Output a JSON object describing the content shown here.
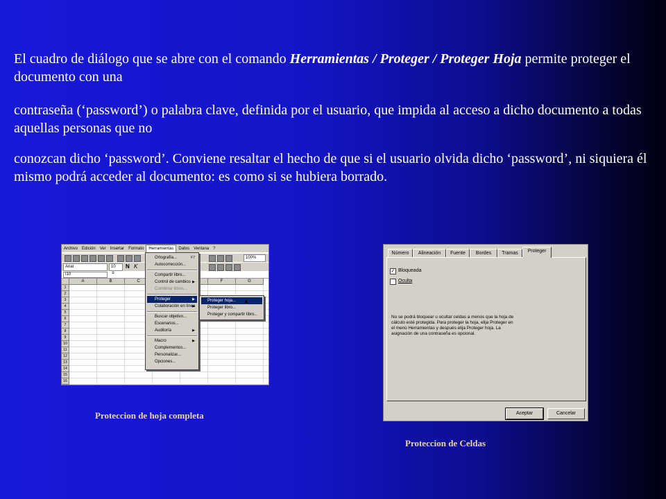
{
  "slide": {
    "para1_pre": "El cuadro de diálogo que se abre con el comando ",
    "para1_em": "Herramientas / Proteger / Proteger Hoja",
    "para1_post": " permite proteger el documento con una",
    "para2": "contraseña (‘password’) o palabra clave, definida por el usuario, que impida al acceso a dicho documento a todas aquellas personas que no",
    "para3": "conozcan dicho ‘password’. Conviene resaltar el hecho de que si el usuario olvida dicho ‘password’, ni siquiera él mismo podrá acceder al documento: es como si se hubiera borrado.",
    "caption_left": "Proteccion de hoja completa",
    "caption_right": "Proteccion de Celdas"
  },
  "excel": {
    "menubar": [
      "Archivo",
      "Edición",
      "Ver",
      "Insertar",
      "Formato",
      "Herramientas",
      "Datos",
      "Ventana",
      "?"
    ],
    "active_menu": "Herramientas",
    "font_name": "Arial",
    "font_size": "10",
    "zoom": "100%",
    "name_box": "I10",
    "columns": [
      "A",
      "B",
      "C",
      "D",
      "E",
      "F",
      "G"
    ],
    "rows": [
      "1",
      "2",
      "3",
      "4",
      "5",
      "6",
      "7",
      "8",
      "9",
      "10",
      "11",
      "12",
      "13",
      "14",
      "15",
      "16"
    ],
    "tools_menu": [
      {
        "label": "Ortografía...",
        "shortcut": "F7"
      },
      {
        "label": "Autocorrección..."
      },
      {
        "sep": true
      },
      {
        "label": "Compartir libro..."
      },
      {
        "label": "Control de cambios",
        "sub": true
      },
      {
        "label": "Combinar libros...",
        "disabled": true
      },
      {
        "sep": true
      },
      {
        "label": "Proteger",
        "sub": true,
        "selected": true
      },
      {
        "label": "Colaboración en línea",
        "sub": true
      },
      {
        "sep": true
      },
      {
        "label": "Buscar objetivo..."
      },
      {
        "label": "Escenarios..."
      },
      {
        "label": "Auditoría",
        "sub": true
      },
      {
        "sep": true
      },
      {
        "label": "Macro",
        "sub": true
      },
      {
        "label": "Complementos..."
      },
      {
        "label": "Personalizar..."
      },
      {
        "label": "Opciones..."
      }
    ],
    "protect_submenu": [
      "Proteger hoja...",
      "Proteger libro...",
      "Proteger y compartir libro..."
    ]
  },
  "dialog": {
    "tabs": [
      "Número",
      "Alineación",
      "Fuente",
      "Bordes",
      "Tramas",
      "Proteger"
    ],
    "active_tab": "Proteger",
    "checkbox_locked": {
      "label": "Bloqueada",
      "checked": true
    },
    "checkbox_hidden": {
      "label": "Oculta",
      "checked": false
    },
    "note": "No se podrá bloquear u ocultar celdas a menos que la hoja de\ncálculo esté protegida. Para proteger la hoja, elija Proteger en\nel menú Herramientas y después elija Proteger hoja. La\nasignación de una contraseña es opcional.",
    "ok_label": "Aceptar",
    "cancel_label": "Cancelar"
  }
}
